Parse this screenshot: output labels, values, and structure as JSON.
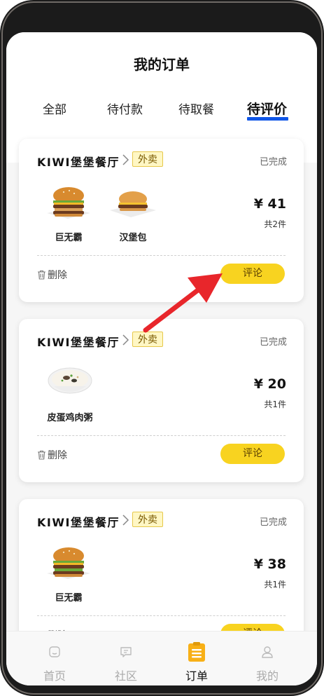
{
  "page": {
    "title": "我的订单"
  },
  "tabs": [
    {
      "label": "全部",
      "active": false
    },
    {
      "label": "待付款",
      "active": false
    },
    {
      "label": "待取餐",
      "active": false
    },
    {
      "label": "待评价",
      "active": true
    }
  ],
  "orders": [
    {
      "shop": "KIWI堡堡餐厅",
      "tag": "外卖",
      "status": "已完成",
      "items": [
        {
          "name": "巨无霸",
          "icon": "big-burger-icon"
        },
        {
          "name": "汉堡包",
          "icon": "burger-icon"
        }
      ],
      "price": "¥ 41",
      "count": "共2件",
      "delete_label": "删除",
      "review_label": "评论"
    },
    {
      "shop": "KIWI堡堡餐厅",
      "tag": "外卖",
      "status": "已完成",
      "items": [
        {
          "name": "皮蛋鸡肉粥",
          "icon": "congee-bowl-icon"
        }
      ],
      "price": "¥ 20",
      "count": "共1件",
      "delete_label": "删除",
      "review_label": "评论"
    },
    {
      "shop": "KIWI堡堡餐厅",
      "tag": "外卖",
      "status": "已完成",
      "items": [
        {
          "name": "巨无霸",
          "icon": "big-burger-icon"
        }
      ],
      "price": "¥ 38",
      "count": "共1件",
      "delete_label": "删除",
      "review_label": "评论"
    }
  ],
  "tabbar": [
    {
      "label": "首页",
      "icon": "home-icon",
      "active": false
    },
    {
      "label": "社区",
      "icon": "chat-icon",
      "active": false
    },
    {
      "label": "订单",
      "icon": "clipboard-icon",
      "active": true
    },
    {
      "label": "我的",
      "icon": "user-icon",
      "active": false
    }
  ],
  "colors": {
    "accent": "#f8d320",
    "tab_underline": "#1157e8",
    "arrow": "#e8262b",
    "tag_bg": "#fff7c4"
  }
}
